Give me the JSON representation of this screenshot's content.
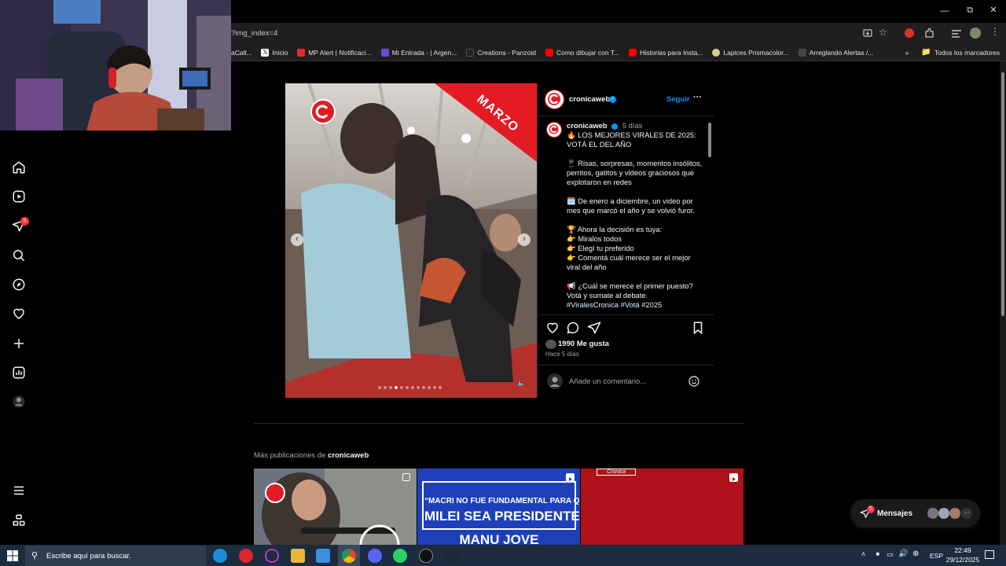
{
  "browser": {
    "url": "?img_index=4",
    "bookmarks": [
      {
        "label": "aCall...",
        "color": "#888888"
      },
      {
        "label": "Inicio",
        "color": "#000000"
      },
      {
        "label": "MP Alert | Notificaci...",
        "color": "#d9302f"
      },
      {
        "label": "Mi Entrada - | Argen...",
        "color": "#6a4bd1"
      },
      {
        "label": "Creations - Panzoid",
        "color": "#222222"
      },
      {
        "label": "Como dibujar con T...",
        "color": "#ff0000"
      },
      {
        "label": "Historias para Insta...",
        "color": "#ff0000"
      },
      {
        "label": "Lapices Prismacolor...",
        "color": "#d6d08a"
      },
      {
        "label": "Arreglando Alertas /...",
        "color": "#444444"
      }
    ],
    "bookmarks_more": "»",
    "all_bookmarks": "Todos los marcadores"
  },
  "nav": {
    "icons": [
      "home-icon",
      "reels-icon",
      "messages-icon",
      "search-icon",
      "explore-icon",
      "heart-icon",
      "create-icon",
      "dashboard-icon",
      "profile-icon"
    ],
    "badge": "5",
    "more_icon": "menu-icon",
    "threads_icon": "threads-icon"
  },
  "post": {
    "overlay_banner": "MARZO",
    "username": "cronicaweb",
    "follow": "Seguir",
    "more": "···",
    "caption_user": "cronicaweb",
    "caption_time": "5 días",
    "caption_lines": [
      "🔥 LOS MEJORES VIRALES DE 2025:",
      "VOTÁ EL DEL AÑO",
      "",
      "📱 Risas, sorpresas, momentos insólitos,",
      "perritos, gatitos y videos graciosos que",
      "explotaron en redes",
      "",
      "🗓️ De enero a diciembre, un video por",
      "mes que marcó el año y se volvió furor.",
      "",
      "🏆 Ahora la decisión es tuya:",
      "👉 Miralos todos",
      "👉 Elegí tu preferido",
      "👉 Comentá cuál merece ser el mejor",
      "viral del año",
      "",
      "📢 ¿Cuál se merece el primer puesto?",
      "Votá y sumate al debate."
    ],
    "hashtags": "#ViralesCronica #Votá #2025",
    "likes": "1990 Me gusta",
    "time_ago": "Hace 5 días",
    "comment_placeholder": "Añade un comentario..."
  },
  "more_posts": {
    "label_prefix": "Más publicaciones de",
    "user": "cronicaweb",
    "thumb2_quote_line1": "“MACRI NO FUE FUNDAMENTAL PARA QUE",
    "thumb2_quote_line2": "MILEI SEA PRESIDENTE”",
    "thumb2_name": "MANU JOVE",
    "thumb3_logo": "Crónica"
  },
  "messages": {
    "label": "Mensajes",
    "badge": "5"
  },
  "taskbar": {
    "search_placeholder": "Escribe aquí para buscar.",
    "lang": "ESP",
    "time": "22:49",
    "date": "29/12/2025"
  },
  "colors": {
    "accent": "#0095f6",
    "brand_red": "#e31b23",
    "badge": "#ff3040"
  }
}
